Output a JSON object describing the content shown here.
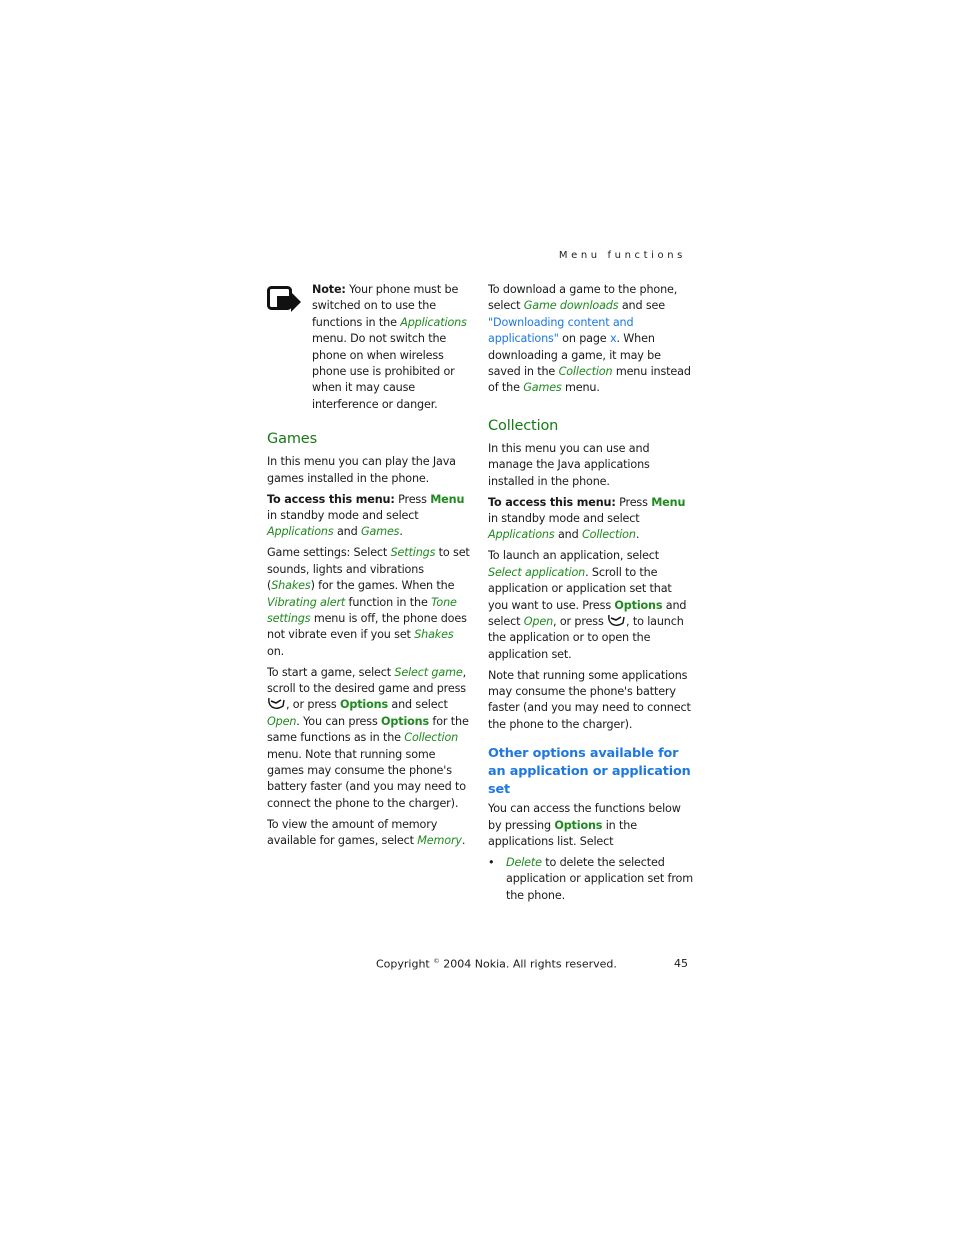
{
  "running_head": "Menu functions",
  "note": {
    "label": "Note:",
    "t1": " Your phone must be switched on to use the functions in the ",
    "applications": "Applications",
    "t2": " menu. Do not switch the phone on when wireless phone use is prohibited or when it may cause interference or danger.",
    "icon": "note-icon"
  },
  "games": {
    "heading": "Games",
    "intro": "In this menu you can play the Java games installed in the phone.",
    "access_label": "To access this menu:",
    "access_t1": " Press ",
    "access_menu": "Menu",
    "access_t2": " in standby mode and select ",
    "access_applications": "Applications",
    "access_t3": " and ",
    "access_games": "Games",
    "access_t4": ".",
    "settings_t1": "Game settings: Select ",
    "settings_settings": "Settings",
    "settings_t2": " to set sounds, lights and vibrations (",
    "settings_shakes": "Shakes",
    "settings_t3": ") for the games. When the ",
    "settings_vibrating": "Vibrating alert",
    "settings_t4": " function in the ",
    "settings_tone": "Tone settings",
    "settings_t5": " menu is off, the phone does not vibrate even if you set ",
    "settings_shakes2": "Shakes",
    "settings_t6": " on.",
    "start_t1": "To start a game, select ",
    "start_select_game": "Select game",
    "start_t2": ", scroll to the desired game and press ",
    "start_t3": ", or press ",
    "start_options": "Options",
    "start_t4": " and select ",
    "start_open": "Open",
    "start_t5": ". You can press ",
    "start_options2": "Options",
    "start_t6": " for the same functions as in the ",
    "start_collection": "Collection",
    "start_t7": " menu. Note that running some games may consume the phone's battery faster (and you may need to connect the phone to the charger).",
    "memory_t1": "To view the amount of memory available for games, select ",
    "memory_memory": "Memory",
    "memory_t2": "."
  },
  "download": {
    "t1": "To download a game to the phone, select ",
    "game_downloads": "Game downloads",
    "t2": " and see ",
    "link": "\"Downloading content and applications\"",
    "t3": " on page ",
    "page_link": "x",
    "t4": ". When downloading a game, it may be saved in the ",
    "collection": "Collection",
    "t5": " menu instead of the ",
    "games": "Games",
    "t6": " menu."
  },
  "collection": {
    "heading": "Collection",
    "intro": "In this menu you can use and manage the Java applications installed in the phone.",
    "access_label": "To access this menu:",
    "access_t1": " Press ",
    "access_menu": "Menu",
    "access_t2": " in standby mode and select ",
    "access_applications": "Applications",
    "access_t3": " and ",
    "access_collection": "Collection",
    "access_t4": ".",
    "launch_t1": "To launch an application, select ",
    "launch_select_app": "Select application",
    "launch_t2": ". Scroll to the application or application set that you want to use. Press ",
    "launch_options": "Options",
    "launch_t3": " and select ",
    "launch_open": "Open",
    "launch_t4": ", or press ",
    "launch_t5": ", to launch the application or to open the application set.",
    "battery_note": "Note that running some applications may consume the phone's battery faster (and you may need to connect the phone to the charger)."
  },
  "other_options": {
    "heading": "Other options available for an application or application set",
    "t1": "You can access the functions below by pressing ",
    "options": "Options",
    "t2": " in the applications list. Select",
    "items": [
      {
        "bullet": "•",
        "term": "Delete",
        "text": " to delete the selected application or application set from the phone."
      }
    ]
  },
  "footer": {
    "copyright_pre": "Copyright ",
    "copyright_symbol": "©",
    "copyright_post": " 2004 Nokia. All rights reserved.",
    "page_number": "45"
  },
  "colors": {
    "green_term": "#1f8a1f",
    "green_heading": "#157a15",
    "blue_heading": "#1e78e0"
  }
}
